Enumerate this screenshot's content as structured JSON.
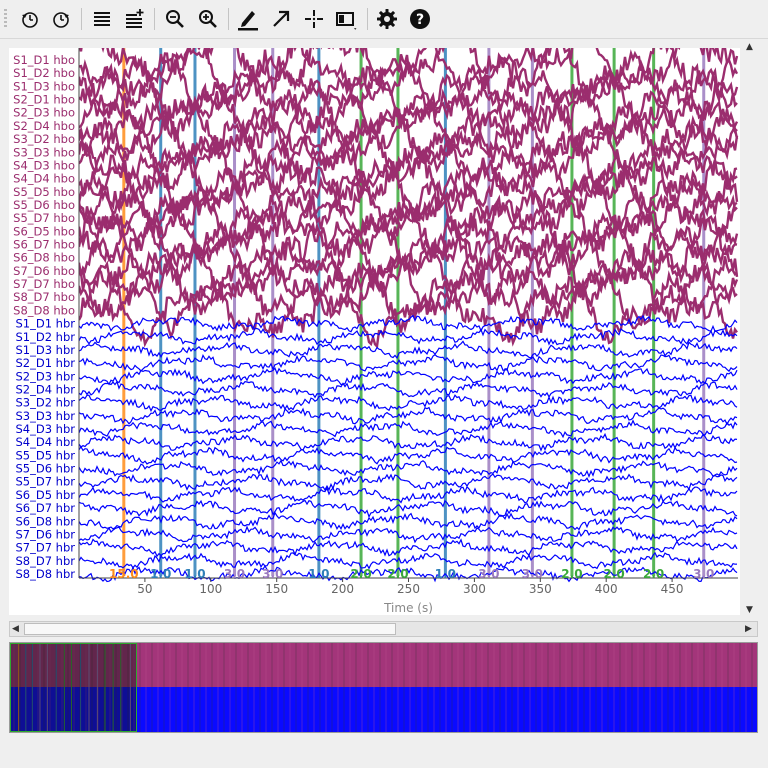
{
  "toolbar": {
    "items": [
      {
        "name": "rewind-icon",
        "label": "◁"
      },
      {
        "name": "forward-icon",
        "label": "▷"
      },
      {
        "name": "fewer-channels-icon",
        "label": "≡"
      },
      {
        "name": "more-channels-icon",
        "label": "≡"
      },
      {
        "name": "zoom-out-icon",
        "label": "−"
      },
      {
        "name": "zoom-in-icon",
        "label": "+"
      },
      {
        "name": "annotation-pen-icon",
        "label": "✎"
      },
      {
        "name": "projector-arrow-icon",
        "label": "↗"
      },
      {
        "name": "crosshair-icon",
        "label": "+"
      },
      {
        "name": "view-layout-icon",
        "label": "▦"
      },
      {
        "name": "settings-gear-icon",
        "label": "⚙"
      },
      {
        "name": "help-icon",
        "label": "?"
      }
    ]
  },
  "channels": {
    "hbo": [
      "S1_D1 hbo",
      "S1_D2 hbo",
      "S1_D3 hbo",
      "S2_D1 hbo",
      "S2_D3 hbo",
      "S2_D4 hbo",
      "S3_D2 hbo",
      "S3_D3 hbo",
      "S4_D3 hbo",
      "S4_D4 hbo",
      "S5_D5 hbo",
      "S5_D6 hbo",
      "S5_D7 hbo",
      "S6_D5 hbo",
      "S6_D7 hbo",
      "S6_D8 hbo",
      "S7_D6 hbo",
      "S7_D7 hbo",
      "S8_D7 hbo",
      "S8_D8 hbo"
    ],
    "hbr": [
      "S1_D1 hbr",
      "S1_D2 hbr",
      "S1_D3 hbr",
      "S2_D1 hbr",
      "S2_D3 hbr",
      "S2_D4 hbr",
      "S3_D2 hbr",
      "S3_D3 hbr",
      "S4_D3 hbr",
      "S4_D4 hbr",
      "S5_D5 hbr",
      "S5_D6 hbr",
      "S5_D7 hbr",
      "S6_D5 hbr",
      "S6_D7 hbr",
      "S6_D8 hbr",
      "S7_D6 hbr",
      "S7_D7 hbr",
      "S8_D7 hbr",
      "S8_D8 hbr"
    ],
    "hbo_color": "#9b2d6e",
    "hbr_color": "#0000ff"
  },
  "time_axis": {
    "label": "Time (s)",
    "min": 0,
    "max": 500,
    "ticks": [
      50,
      100,
      150,
      200,
      250,
      300,
      350,
      400,
      450
    ]
  },
  "events": [
    {
      "t": 34,
      "label": "15.0",
      "color": "#ff8c1a"
    },
    {
      "t": 62,
      "label": "1.0",
      "color": "#2e7fb8"
    },
    {
      "t": 88,
      "label": "1.0",
      "color": "#2e7fb8"
    },
    {
      "t": 118,
      "label": "3.0",
      "color": "#9b7bbf"
    },
    {
      "t": 147,
      "label": "3.0",
      "color": "#9b7bbf"
    },
    {
      "t": 182,
      "label": "1.0",
      "color": "#2e7fb8"
    },
    {
      "t": 214,
      "label": "2.0",
      "color": "#3aa83a"
    },
    {
      "t": 242,
      "label": "2.0",
      "color": "#3aa83a"
    },
    {
      "t": 278,
      "label": "1.0",
      "color": "#2e7fb8"
    },
    {
      "t": 311,
      "label": "3.0",
      "color": "#9b7bbf"
    },
    {
      "t": 344,
      "label": "3.0",
      "color": "#9b7bbf"
    },
    {
      "t": 374,
      "label": "2.0",
      "color": "#3aa83a"
    },
    {
      "t": 406,
      "label": "2.0",
      "color": "#3aa83a"
    },
    {
      "t": 436,
      "label": "2.0",
      "color": "#3aa83a"
    },
    {
      "t": 474,
      "label": "3.0",
      "color": "#9b7bbf"
    }
  ],
  "overview": {
    "view_fraction": 0.17,
    "hbo_color": "#a3357a",
    "hbr_color": "#0a0aff"
  }
}
